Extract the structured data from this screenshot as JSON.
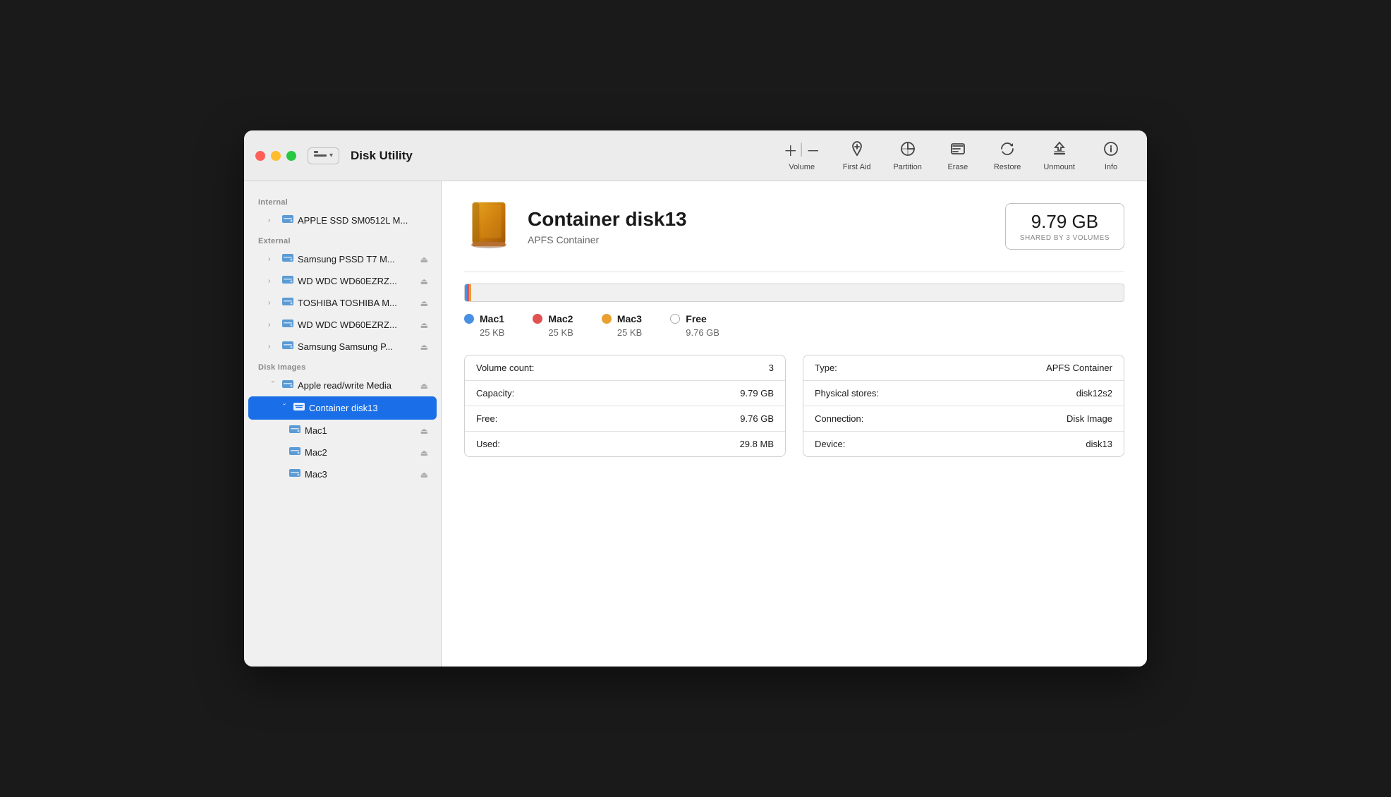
{
  "window": {
    "title": "Disk Utility"
  },
  "toolbar": {
    "view_label": "View",
    "volume_label": "Volume",
    "firstaid_label": "First Aid",
    "partition_label": "Partition",
    "erase_label": "Erase",
    "restore_label": "Restore",
    "unmount_label": "Unmount",
    "info_label": "Info"
  },
  "sidebar": {
    "sections": [
      {
        "label": "Internal",
        "items": [
          {
            "id": "apple-ssd",
            "text": "APPLE SSD SM0512L M...",
            "indent": 1,
            "hasChevron": true,
            "hasEject": false
          }
        ]
      },
      {
        "label": "External",
        "items": [
          {
            "id": "samsung-pssd",
            "text": "Samsung PSSD T7 M...",
            "indent": 1,
            "hasChevron": true,
            "hasEject": true
          },
          {
            "id": "wd-wdc1",
            "text": "WD WDC WD60EZRZ...",
            "indent": 1,
            "hasChevron": true,
            "hasEject": true
          },
          {
            "id": "toshiba",
            "text": "TOSHIBA TOSHIBA M...",
            "indent": 1,
            "hasChevron": true,
            "hasEject": true
          },
          {
            "id": "wd-wdc2",
            "text": "WD WDC WD60EZRZ...",
            "indent": 1,
            "hasChevron": true,
            "hasEject": true
          },
          {
            "id": "samsung-p",
            "text": "Samsung Samsung P...",
            "indent": 1,
            "hasChevron": true,
            "hasEject": true
          }
        ]
      },
      {
        "label": "Disk Images",
        "items": [
          {
            "id": "apple-rw",
            "text": "Apple read/write Media",
            "indent": 1,
            "hasChevron": true,
            "expanded": true,
            "hasEject": true
          },
          {
            "id": "container-disk13",
            "text": "Container disk13",
            "indent": 2,
            "selected": true,
            "isContainer": true,
            "hasEject": false
          },
          {
            "id": "mac1",
            "text": "Mac1",
            "indent": 3,
            "hasEject": true
          },
          {
            "id": "mac2",
            "text": "Mac2",
            "indent": 3,
            "hasEject": true
          },
          {
            "id": "mac3",
            "text": "Mac3",
            "indent": 3,
            "hasEject": true
          }
        ]
      }
    ]
  },
  "detail": {
    "disk_name": "Container disk13",
    "disk_type_label": "APFS Container",
    "size_value": "9.79 GB",
    "size_sub": "Shared by 3 volumes",
    "volumes": [
      {
        "id": "mac1",
        "color_class": "mac1",
        "name": "Mac1",
        "size": "25 KB"
      },
      {
        "id": "mac2",
        "color_class": "mac2",
        "name": "Mac2",
        "size": "25 KB"
      },
      {
        "id": "mac3",
        "color_class": "mac3",
        "name": "Mac3",
        "size": "25 KB"
      },
      {
        "id": "free",
        "color_class": "free",
        "name": "Free",
        "size": "9.76 GB"
      }
    ],
    "left_table": [
      {
        "key": "Volume count:",
        "value": "3"
      },
      {
        "key": "Capacity:",
        "value": "9.79 GB"
      },
      {
        "key": "Free:",
        "value": "9.76 GB"
      },
      {
        "key": "Used:",
        "value": "29.8 MB"
      }
    ],
    "right_table": [
      {
        "key": "Type:",
        "value": "APFS Container"
      },
      {
        "key": "Physical stores:",
        "value": "disk12s2"
      },
      {
        "key": "Connection:",
        "value": "Disk Image"
      },
      {
        "key": "Device:",
        "value": "disk13"
      }
    ]
  }
}
